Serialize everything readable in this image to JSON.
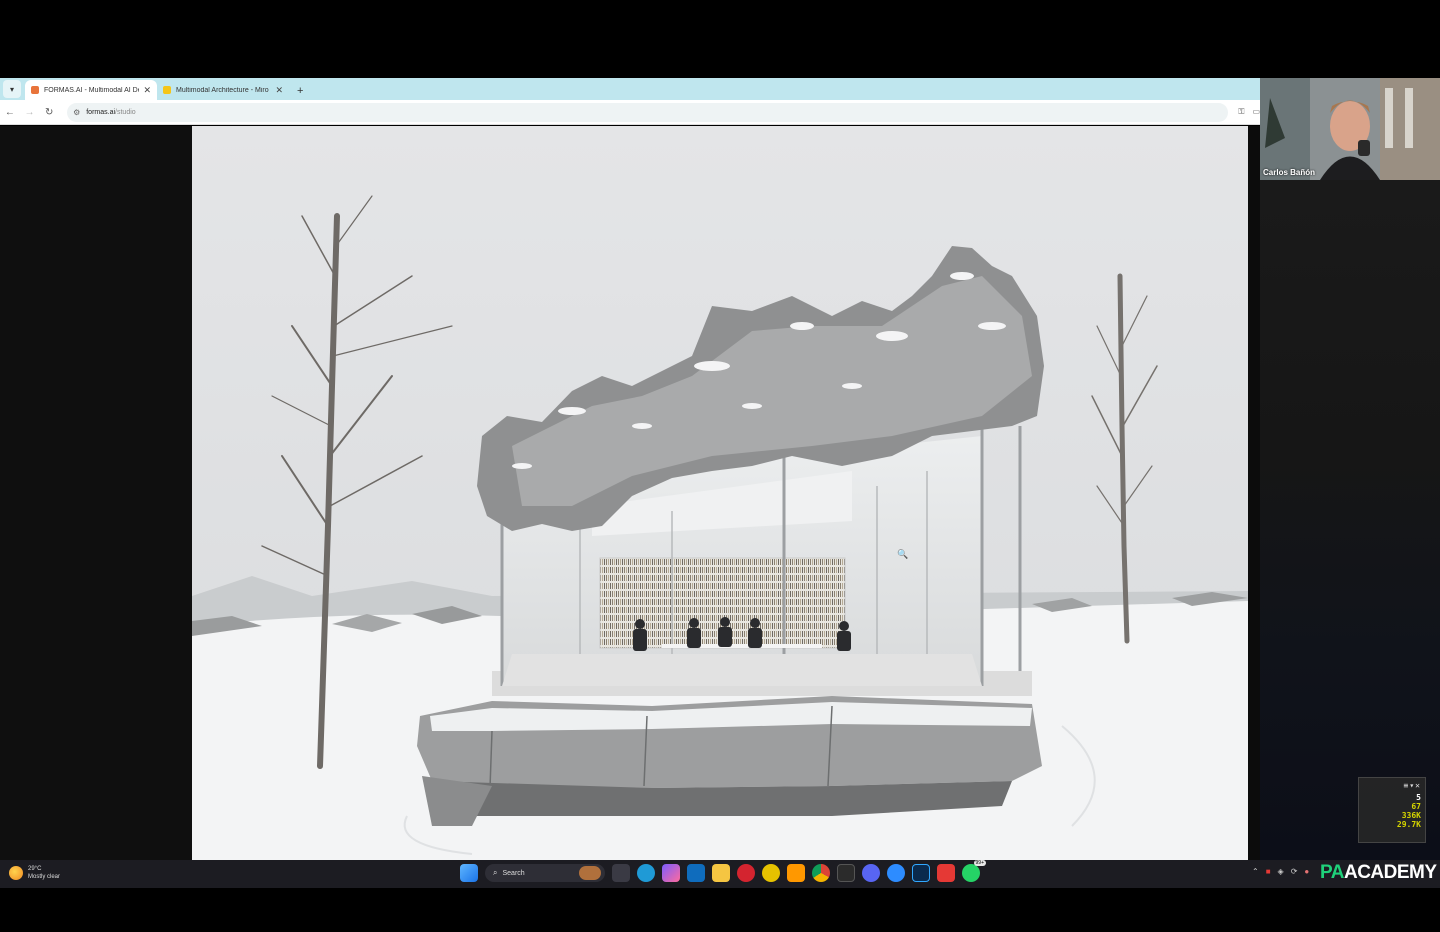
{
  "browser": {
    "tabs": [
      {
        "title": "FORMAS.AI - Multimodal AI De",
        "favicon_color": "#e8743b",
        "active": true
      },
      {
        "title": "Multimodal Architecture - Miro",
        "favicon_color": "#f5c518",
        "active": false
      }
    ],
    "new_tab_label": "+",
    "address": {
      "host": "formas.ai",
      "path": "/studio"
    }
  },
  "webcam": {
    "name": "Carlos Bañón"
  },
  "stats": {
    "values": [
      "5",
      "67",
      "336K",
      "29.7K"
    ]
  },
  "taskbar": {
    "weather": {
      "temp": "29°C",
      "condition": "Mostly clear"
    },
    "search_label": "Search",
    "whatsapp_badge": "99+"
  },
  "watermark": {
    "prefix": "PA",
    "suffix": "ACADEMY"
  },
  "colors": {
    "tabbar": "#bfe6ee",
    "sky": "#e6e8ea",
    "snow": "#f3f4f5",
    "taskbar": "#1c1c22"
  }
}
